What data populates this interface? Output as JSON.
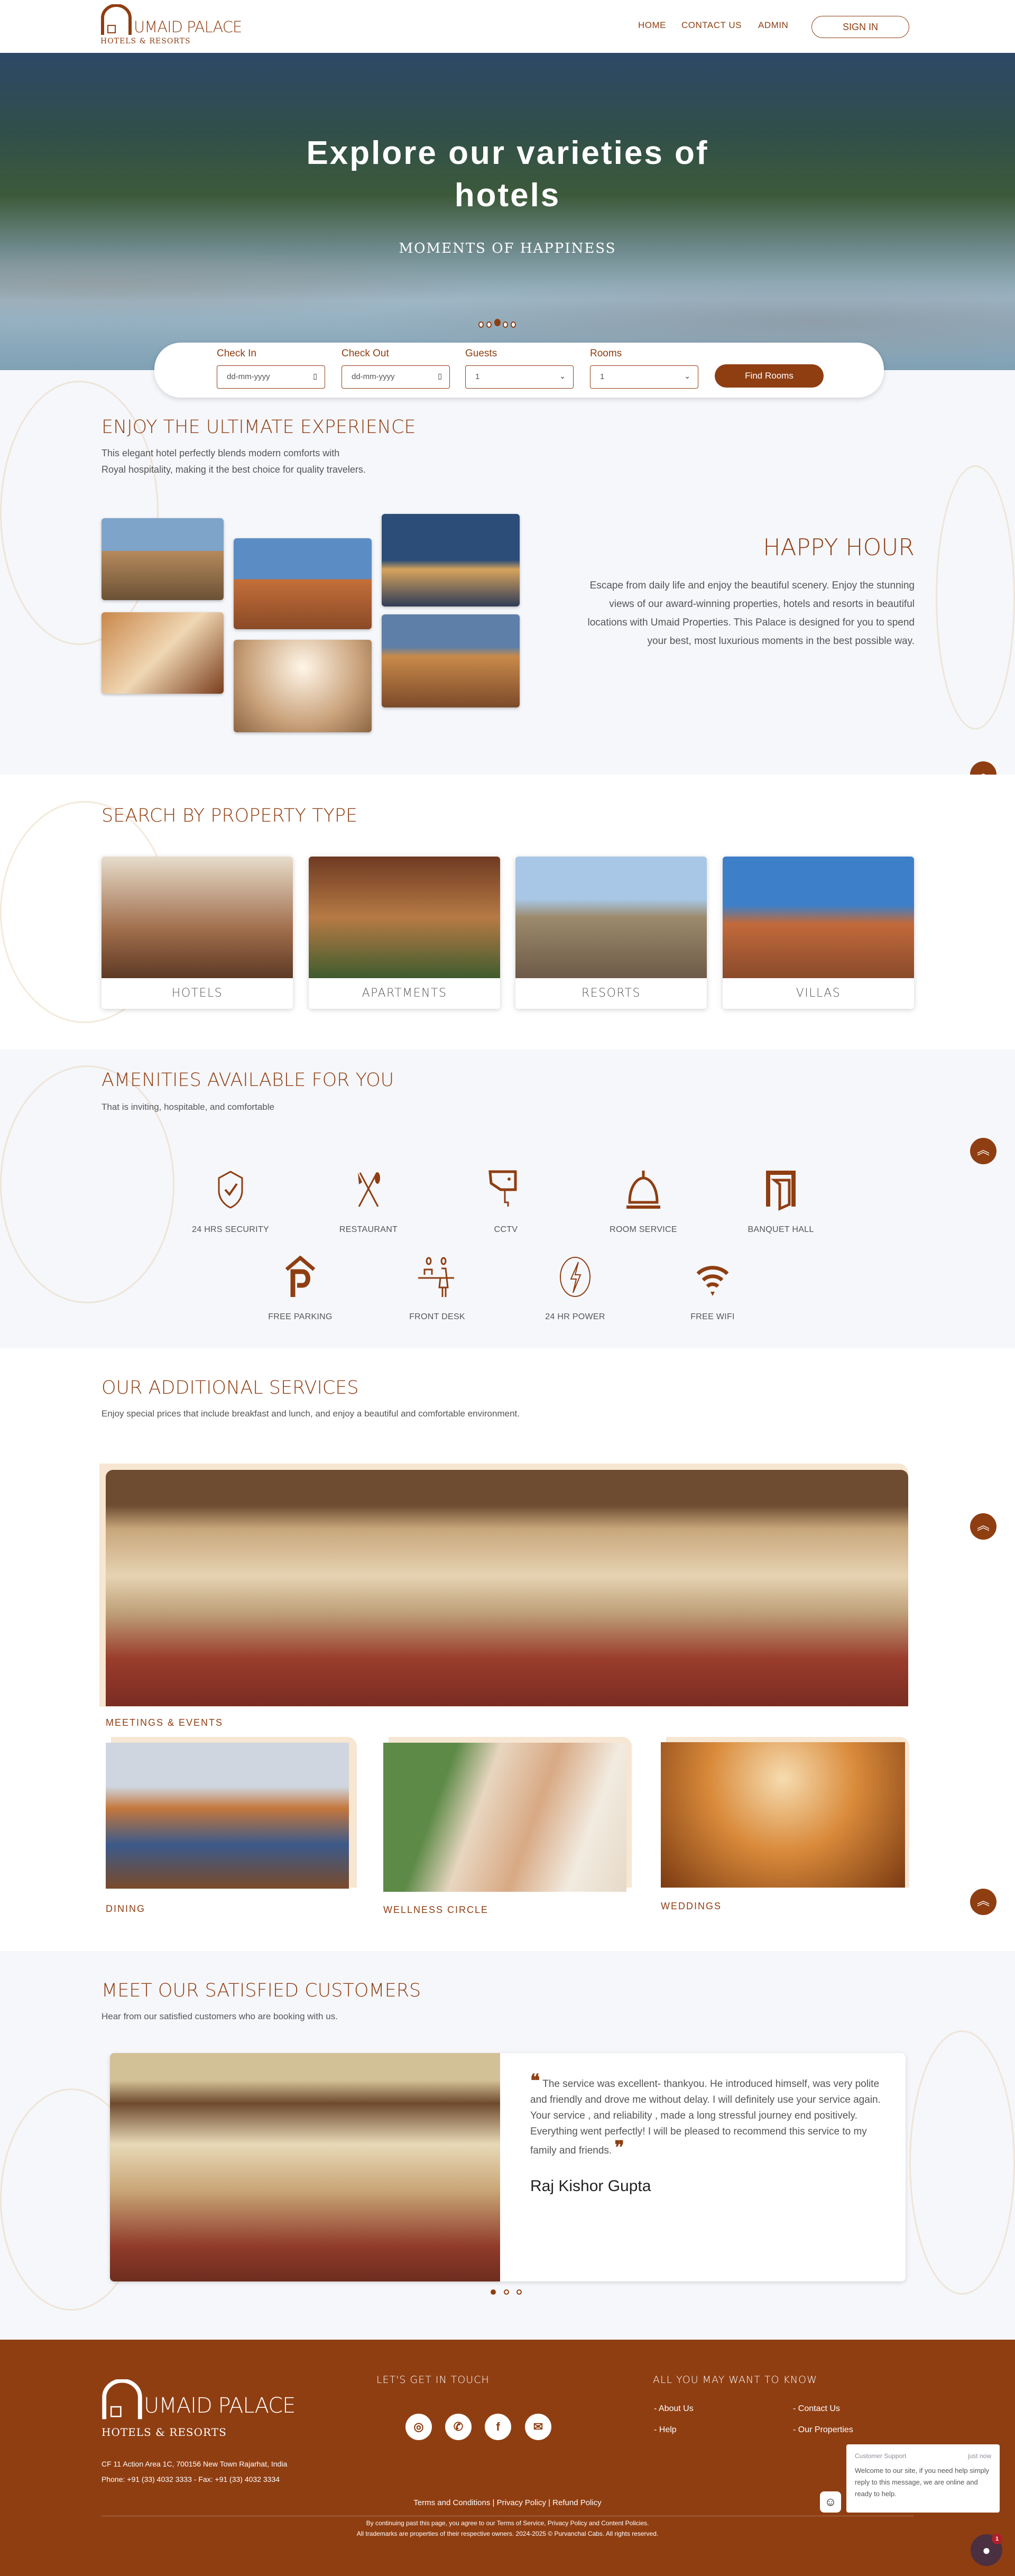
{
  "header": {
    "brand": "UMAID PALACE",
    "tagline": "HOTELS & RESORTS",
    "nav": [
      "HOME",
      "CONTACT US",
      "ADMIN"
    ],
    "sign_in": "SIGN IN"
  },
  "hero": {
    "title": "Explore our varieties of hotels",
    "subtitle": "MOMENTS OF HAPPINESS",
    "slides": 5,
    "active_slide": 3
  },
  "booking": {
    "check_in_label": "Check In",
    "check_out_label": "Check Out",
    "guests_label": "Guests",
    "rooms_label": "Rooms",
    "date_placeholder": "dd-mm-yyyy",
    "guests_value": "1",
    "rooms_value": "1",
    "find_button": "Find Rooms"
  },
  "experience": {
    "title": "ENJOY THE ULTIMATE EXPERIENCE",
    "line1": "This elegant hotel perfectly blends modern comforts with",
    "line2": "Royal hospitality, making it the best choice for quality travelers.",
    "happy_title": "HAPPY HOUR",
    "happy_text": "Escape from daily life and enjoy the beautiful scenery. Enjoy the stunning views of our award-winning properties, hotels and resorts in beautiful locations with Umaid Properties. This Palace is designed for you to spend your best, most luxurious moments in the best possible way."
  },
  "property": {
    "title": "SEARCH BY PROPERTY TYPE",
    "types": [
      "HOTELS",
      "APARTMENTS",
      "RESORTS",
      "VILLAS"
    ]
  },
  "amenities": {
    "title": "AMENITIES AVAILABLE FOR YOU",
    "subtitle": "That is inviting, hospitable, and comfortable",
    "items": [
      {
        "label": "24 HRS SECURITY",
        "icon": "shield-check-icon"
      },
      {
        "label": "RESTAURANT",
        "icon": "fork-spoon-icon"
      },
      {
        "label": "CCTV",
        "icon": "cctv-icon"
      },
      {
        "label": "ROOM SERVICE",
        "icon": "cloche-icon"
      },
      {
        "label": "BANQUET HALL",
        "icon": "door-icon"
      },
      {
        "label": "FREE PARKING",
        "icon": "parking-icon"
      },
      {
        "label": "FRONT DESK",
        "icon": "front-desk-icon"
      },
      {
        "label": "24 HR POWER",
        "icon": "lightning-icon"
      },
      {
        "label": "FREE WIFI",
        "icon": "wifi-icon"
      }
    ]
  },
  "services": {
    "title": "OUR ADDITIONAL SERVICES",
    "subtitle": "Enjoy special prices that include breakfast and lunch, and enjoy a beautiful and comfortable environment.",
    "items": [
      "MEETINGS & EVENTS",
      "DINING",
      "WELLNESS CIRCLE",
      "WEDDINGS"
    ]
  },
  "customers": {
    "title": "MEET OUR SATISFIED CUSTOMERS",
    "subtitle": "Hear from our satisfied customers who are booking with us.",
    "quote": "The service was excellent- thankyou. He introduced himself, was very polite and friendly and drove me without delay. I will definitely use your service again. Your service , and reliability , made a long stressful journey end positively. Everything went perfectly! I will be pleased to recommend this service to my family and friends.",
    "author": "Raj Kishor Gupta",
    "slides": 3,
    "active_slide": 1
  },
  "footer": {
    "brand": "UMAID PALACE",
    "tagline": "HOTELS & RESORTS",
    "address": "CF 11 Action Area 1C, 700156 New Town Rajarhat, India",
    "phone": "Phone: +91 (33) 4032 3333 - Fax: +91 (33) 4032 3334",
    "touch_title": "LET'S GET IN TOUCH",
    "know_title": "ALL YOU MAY WANT TO KNOW",
    "links": [
      "About Us",
      "Contact Us",
      "Help",
      "Our Properties"
    ],
    "policies": "Terms and Conditions | Privacy Policy | Refund Policy",
    "legal1": "By continuing past this page, you agree to our Terms of Service, Privacy Policy and Content Policies.",
    "legal2": "All trademarks are properties of their respective owners. 2024-2025 © Purvanchal Cabs. All rights reserved."
  },
  "chat": {
    "sender": "Customer Support",
    "time": "just now",
    "message": "Welcome to our site, if you need help simply reply to this message, we are online and ready to help.",
    "badge": "1"
  },
  "colors": {
    "brand": "#8f3e12",
    "section_bg": "#f6f7fb",
    "accent_beige": "#f6e6d2"
  }
}
